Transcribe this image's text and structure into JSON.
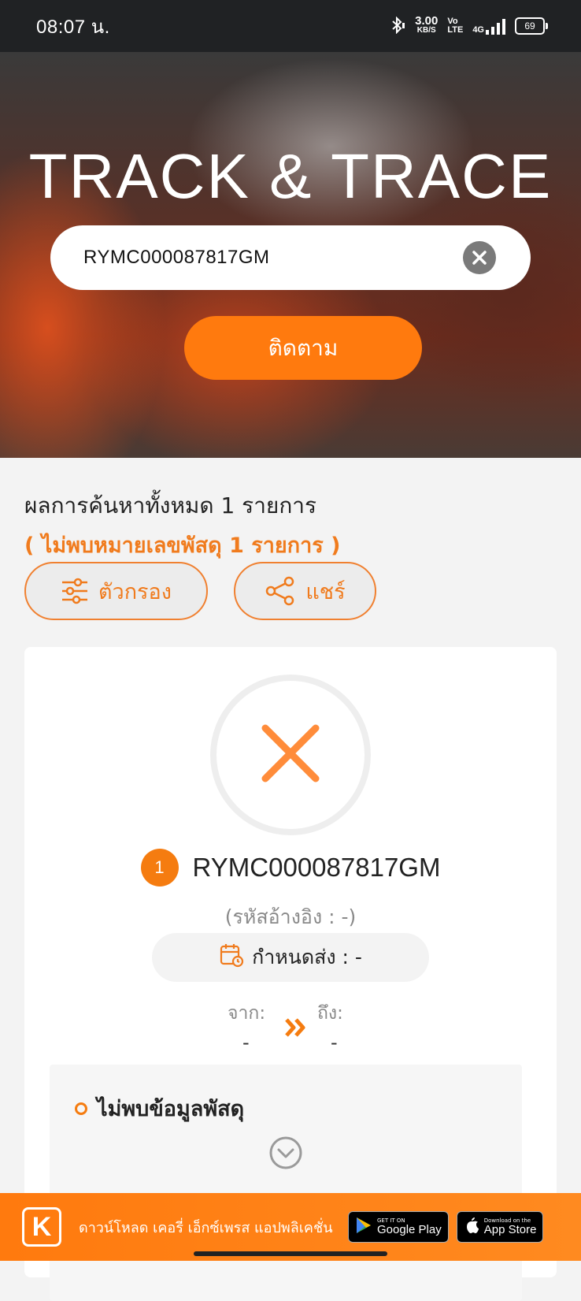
{
  "status_bar": {
    "time": "08:07 น.",
    "speed_value": "3.00",
    "speed_unit": "KB/S",
    "volte_top": "Vo",
    "volte_bottom": "LTE",
    "network": "4G",
    "battery": "69"
  },
  "hero": {
    "title": "TRACK & TRACE",
    "search_value": "RYMC000087817GM",
    "track_button": "ติดตาม"
  },
  "results": {
    "summary": "ผลการค้นหาทั้งหมด 1 รายการ",
    "not_found": "( ไม่พบหมายเลขพัสดุ 1 รายการ )",
    "filter_label": "ตัวกรอง",
    "share_label": "แชร์"
  },
  "parcel": {
    "index": "1",
    "number": "RYMC000087817GM",
    "reference": "(รหัสอ้างอิง : -)",
    "due": "กำหนดส่ง : -",
    "from_label": "จาก:",
    "from_value": "-",
    "to_label": "ถึง:",
    "to_value": "-",
    "info_heading": "ไม่พบข้อมูลพัสดุ"
  },
  "banner": {
    "logo_letter": "K",
    "text": "ดาวน์โหลด เคอรี่ เอ็กซ์เพรส แอปพลิเคชั่น",
    "google_small": "GET IT ON",
    "google_big": "Google Play",
    "apple_small": "Download on the",
    "apple_big": "App Store"
  },
  "colors": {
    "accent": "#ff7a0e",
    "error_x": "#ff8c3a"
  }
}
